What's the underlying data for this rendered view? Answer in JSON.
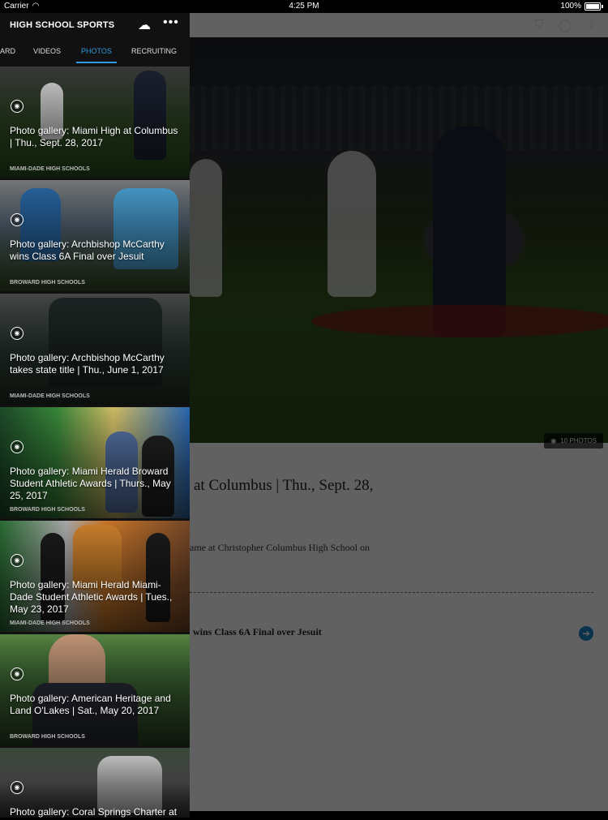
{
  "status_bar": {
    "carrier": "Carrier",
    "time": "4:25 PM",
    "battery": "100%"
  },
  "sidebar": {
    "title": "HIGH SCHOOL SPORTS",
    "tabs": [
      {
        "label": "ARD"
      },
      {
        "label": "VIDEOS"
      },
      {
        "label": "PHOTOS",
        "active": true
      },
      {
        "label": "RECRUITING"
      }
    ],
    "cards": [
      {
        "title": "Photo gallery: Miami High at Columbus | Thu., Sept. 28, 2017",
        "section": "MIAMI-DADE HIGH SCHOOLS"
      },
      {
        "title": "Photo gallery: Archbishop McCarthy wins Class 6A Final over Jesuit",
        "section": "BROWARD HIGH SCHOOLS"
      },
      {
        "title": "Photo gallery: Archbishop McCarthy takes state title | Thu., June 1, 2017",
        "section": "MIAMI-DADE HIGH SCHOOLS"
      },
      {
        "title": "Photo gallery: Miami Herald Broward Student Athletic Awards | Thurs., May 25, 2017",
        "section": "BROWARD HIGH SCHOOLS"
      },
      {
        "title": "Photo gallery: Miami Herald Miami-Dade Student Athletic Awards | Tues., May 23, 2017",
        "section": "MIAMI-DADE HIGH SCHOOLS"
      },
      {
        "title": "Photo gallery: American Heritage and Land O'Lakes | Sat., May 20, 2017",
        "section": "BROWARD HIGH SCHOOLS"
      },
      {
        "title": "Photo gallery: Coral Springs Charter at",
        "section": ""
      }
    ]
  },
  "article": {
    "photo_count": "10 PHOTOS",
    "title": "at Columbus | Thu., Sept. 28,",
    "body": "ame at Christopher Columbus High School on",
    "related": "wins Class 6A Final over Jesuit"
  },
  "colors": {
    "accent": "#2f9ae0",
    "arrow": "#1b83c9"
  }
}
